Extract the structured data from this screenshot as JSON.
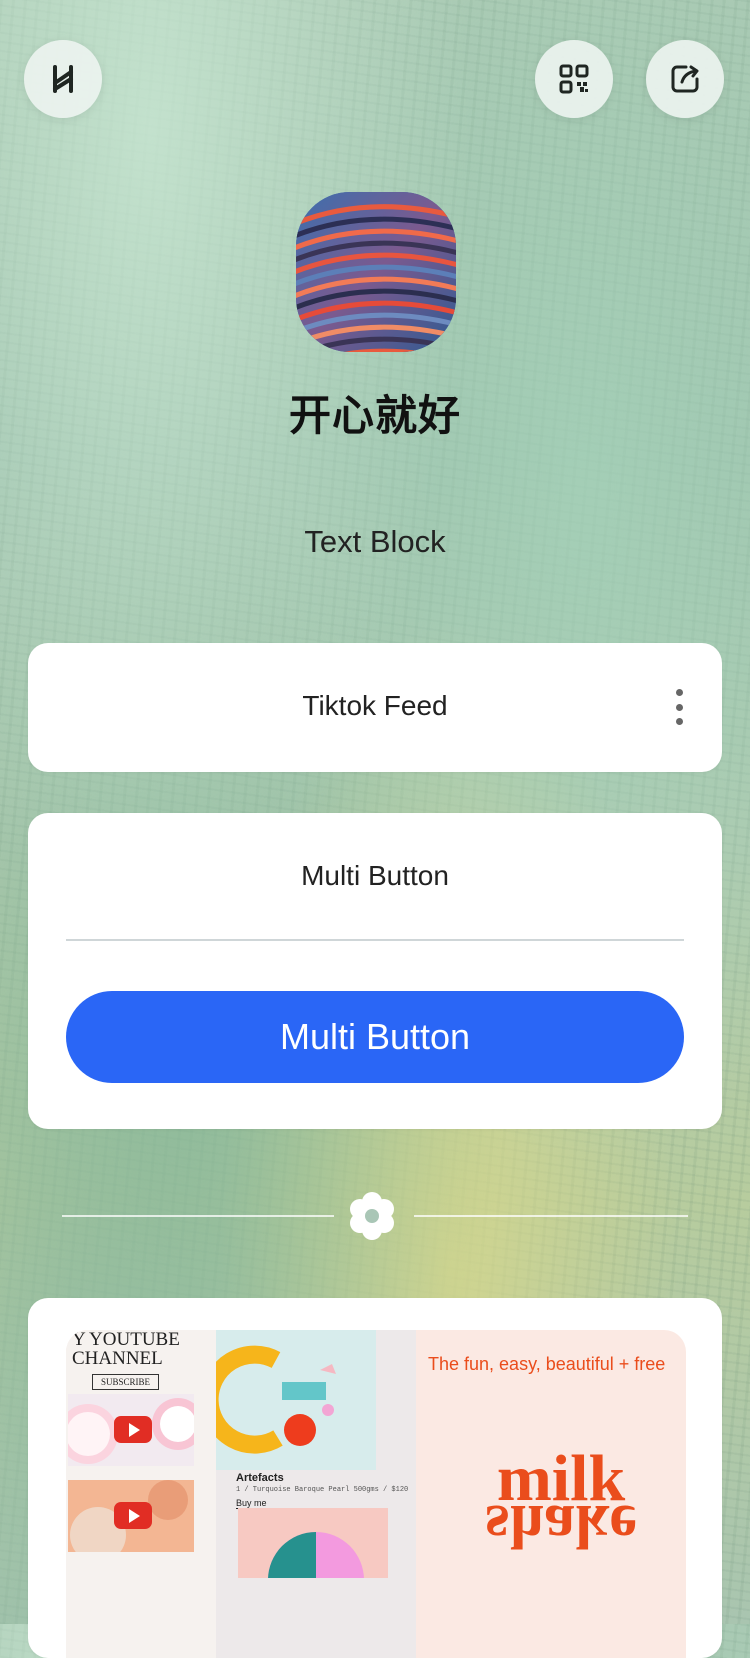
{
  "top_bar": {
    "left_icon": "linktree-logo-icon",
    "right_icons": [
      "qr-code-icon",
      "share-icon"
    ]
  },
  "profile": {
    "name": "开心就好",
    "avatar_icon": "avatar-gradient-stripes"
  },
  "text_block": {
    "text": "Text Block"
  },
  "tiktok_feed": {
    "title": "Tiktok Feed",
    "more_icon": "more-vertical-icon"
  },
  "multi_button": {
    "title": "Multi Button",
    "button_label": "Multi Button",
    "accent_color": "#2a66f6"
  },
  "divider": {
    "icon": "flower-icon"
  },
  "media_card": {
    "youtube": {
      "title_line1": "Y YOUTUBE",
      "title_line2": "CHANNEL",
      "subscribe": "SUBSCRIBE"
    },
    "artefacts": {
      "title": "Artefacts",
      "meta": "1 / Turquoise Baroque Pearl 500gms / $120",
      "buy": "Buy me"
    },
    "milkshake": {
      "tagline": "The fun, easy, beautiful + free",
      "logo_top": "milk",
      "logo_bottom": "shake",
      "brand_color": "#ea4d1c"
    }
  }
}
